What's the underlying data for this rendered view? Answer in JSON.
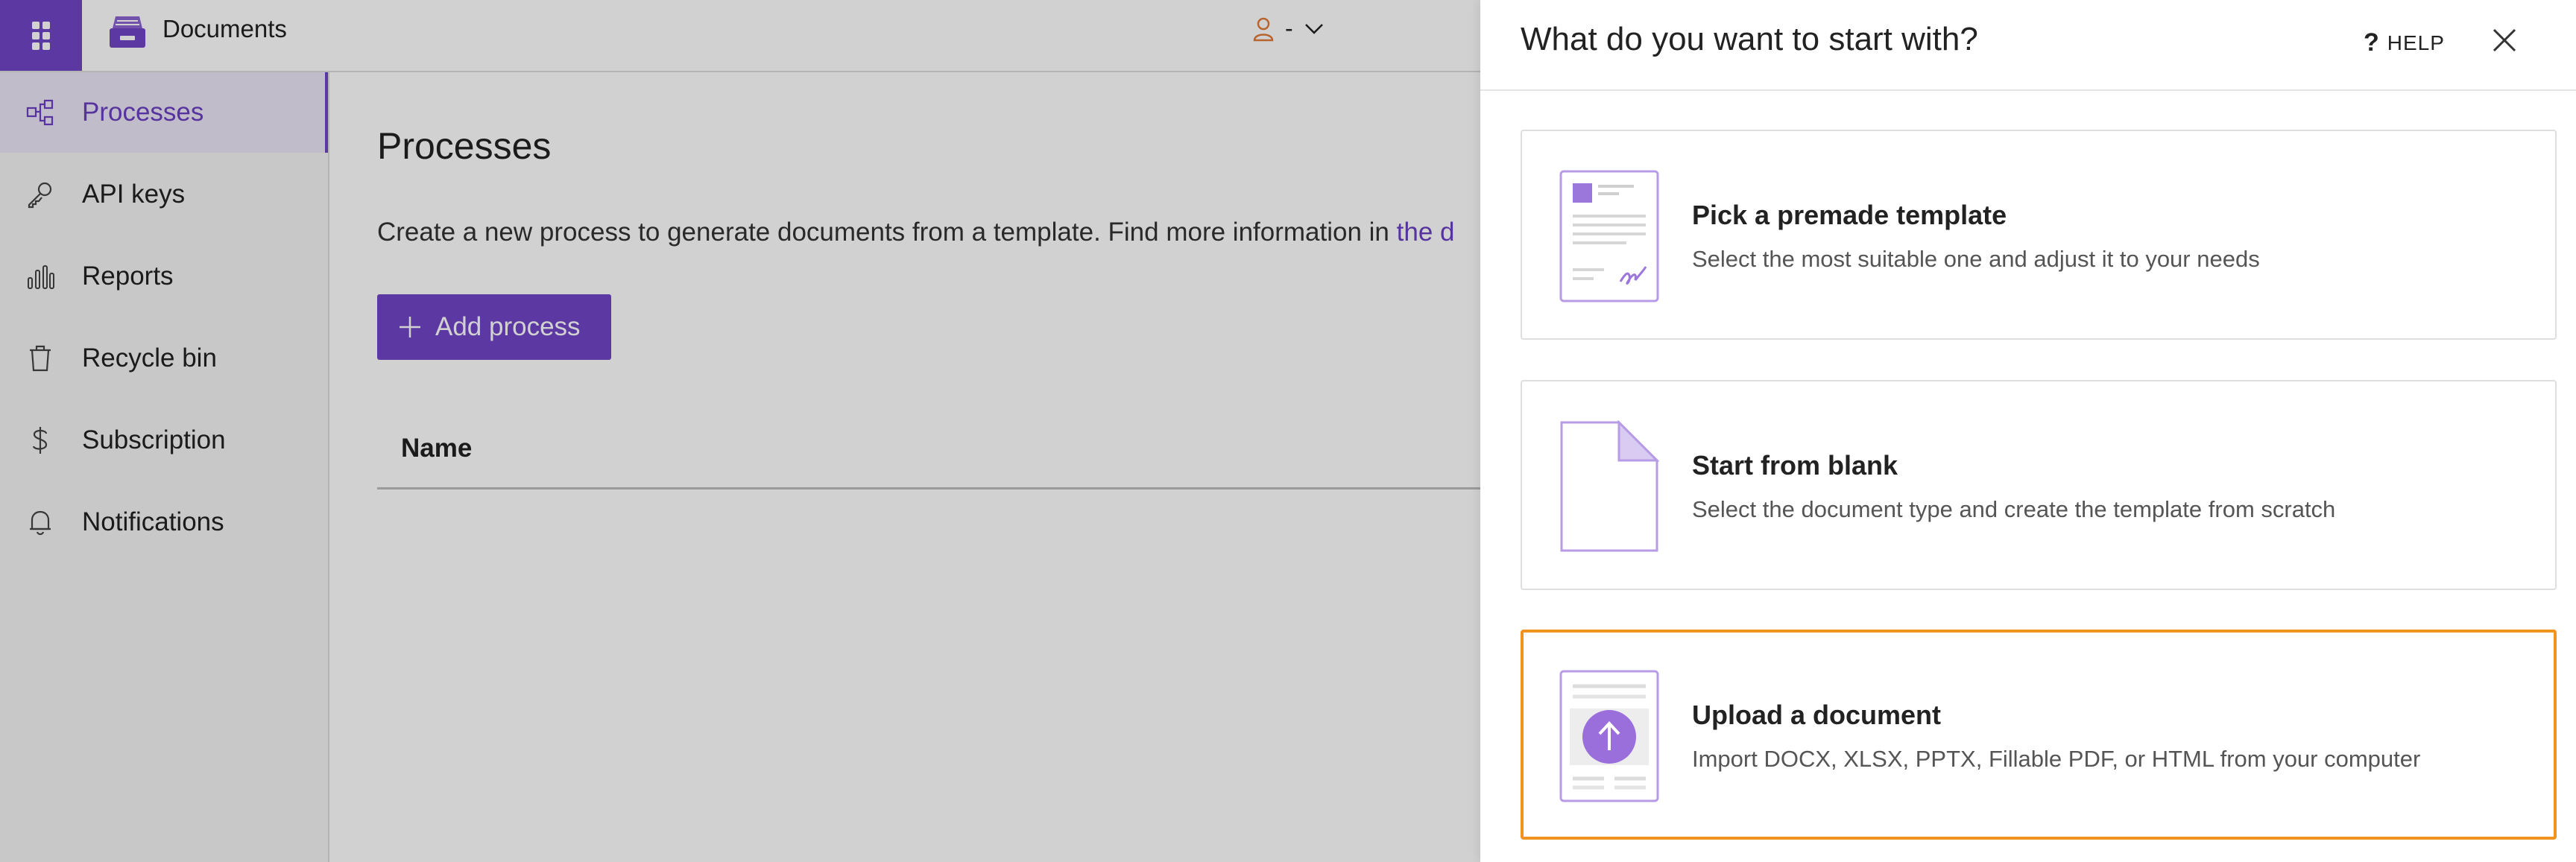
{
  "app": {
    "title": "Documents",
    "user_label": "-"
  },
  "sidebar": {
    "items": [
      {
        "label": "Processes",
        "icon": "processes-icon",
        "active": true
      },
      {
        "label": "API keys",
        "icon": "key-icon"
      },
      {
        "label": "Reports",
        "icon": "bar-chart-icon"
      },
      {
        "label": "Recycle bin",
        "icon": "trash-icon"
      },
      {
        "label": "Subscription",
        "icon": "dollar-icon"
      },
      {
        "label": "Notifications",
        "icon": "bell-icon"
      }
    ]
  },
  "main": {
    "title": "Processes",
    "description": "Create a new process to generate documents from a template. Find more information in ",
    "description_link": "the d",
    "add_button": "Add process",
    "columns": [
      "Name"
    ]
  },
  "drawer": {
    "title": "What do you want to start with?",
    "help_label": "HELP",
    "options": [
      {
        "title": "Pick a premade template",
        "description": "Select the most suitable one and adjust it to your needs"
      },
      {
        "title": "Start from blank",
        "description": "Select the document type and create the template from scratch"
      },
      {
        "title": "Upload a document",
        "description": "Import DOCX, XLSX, PPTX, Fillable PDF, or HTML from your computer",
        "selected": true
      }
    ]
  },
  "colors": {
    "brand": "#7045c6",
    "selection": "#f0931f",
    "user_icon": "#e07b39"
  }
}
